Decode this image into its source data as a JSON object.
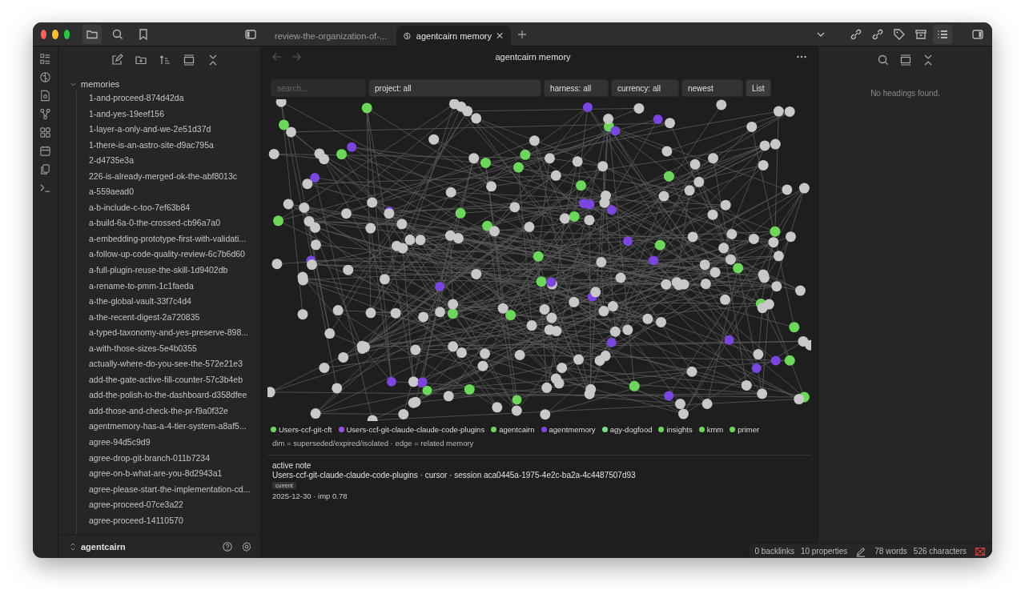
{
  "window": {
    "tabs": [
      {
        "label": "review-the-organization-of-...",
        "selected": false
      },
      {
        "label": "agentcairn memory",
        "selected": true
      }
    ]
  },
  "sidebar": {
    "folder": {
      "label": "memories",
      "expanded": true
    },
    "items": [
      "1-and-proceed-874d42da",
      "1-and-yes-19eef156",
      "1-layer-a-only-and-we-2e51d37d",
      "1-there-is-an-astro-site-d9ac795a",
      "2-d4735e3a",
      "226-is-already-merged-ok-the-abf8013c",
      "a-559aead0",
      "a-b-include-c-too-7ef63b84",
      "a-build-6a-0-the-crossed-cb96a7a0",
      "a-embedding-prototype-first-with-validati...",
      "a-follow-up-code-quality-review-6c7b6d60",
      "a-full-plugin-reuse-the-skill-1d9402db",
      "a-rename-to-pmm-1c1faeda",
      "a-the-global-vault-33f7c4d4",
      "a-the-recent-digest-2a720835",
      "a-typed-taxonomy-and-yes-preserve-898...",
      "a-with-those-sizes-5e4b0355",
      "actually-where-do-you-see-the-572e21e3",
      "add-the-gate-active-fill-counter-57c3b4eb",
      "add-the-polish-to-the-dashboard-d358dfee",
      "add-those-and-check-the-pr-f9a0f32e",
      "agentmemory-has-a-4-tier-system-a8af5...",
      "agree-94d5c9d9",
      "agree-drop-git-branch-011b7234",
      "agree-on-b-what-are-you-8d2943a1",
      "agree-please-start-the-implementation-cd...",
      "agree-proceed-07ce3a22",
      "agree-proceed-14110570"
    ]
  },
  "vault": {
    "name": "agentcairn"
  },
  "view": {
    "title": "agentcairn memory",
    "search": {
      "placeholder": "search..."
    },
    "selects": [
      "project: all",
      "harness: all",
      "currency: all",
      "newest"
    ],
    "button": "List",
    "legend": [
      {
        "label": "Users-ccf-git-cft",
        "color": "#6bd85a"
      },
      {
        "label": "Users-ccf-git-claude-claude-code-plugins",
        "color": "#a050e0"
      },
      {
        "label": "agentcairn",
        "color": "#6bd85a"
      },
      {
        "label": "agentmemory",
        "color": "#7a45e0"
      },
      {
        "label": "agy-dogfood",
        "color": "#76dc8a"
      },
      {
        "label": "insights",
        "color": "#6bd85a"
      },
      {
        "label": "kmm",
        "color": "#6bd85a"
      },
      {
        "label": "primer",
        "color": "#6bd85a"
      }
    ],
    "legend_note": "dim = superseded/expired/isolated · edge = related memory",
    "active_note": {
      "heading": "active note",
      "meta": "Users-ccf-git-claude-claude-code-plugins · cursor · session aca0445a-1975-4e2c-ba2a-4c4487507d93",
      "badge": "current",
      "detail": "2025-12-30 · imp 0.78"
    }
  },
  "outline": {
    "empty": "No headings found."
  },
  "status_bar": {
    "backlinks": "0 backlinks",
    "properties": "10 properties",
    "words": "78 words",
    "characters": "526 characters"
  }
}
